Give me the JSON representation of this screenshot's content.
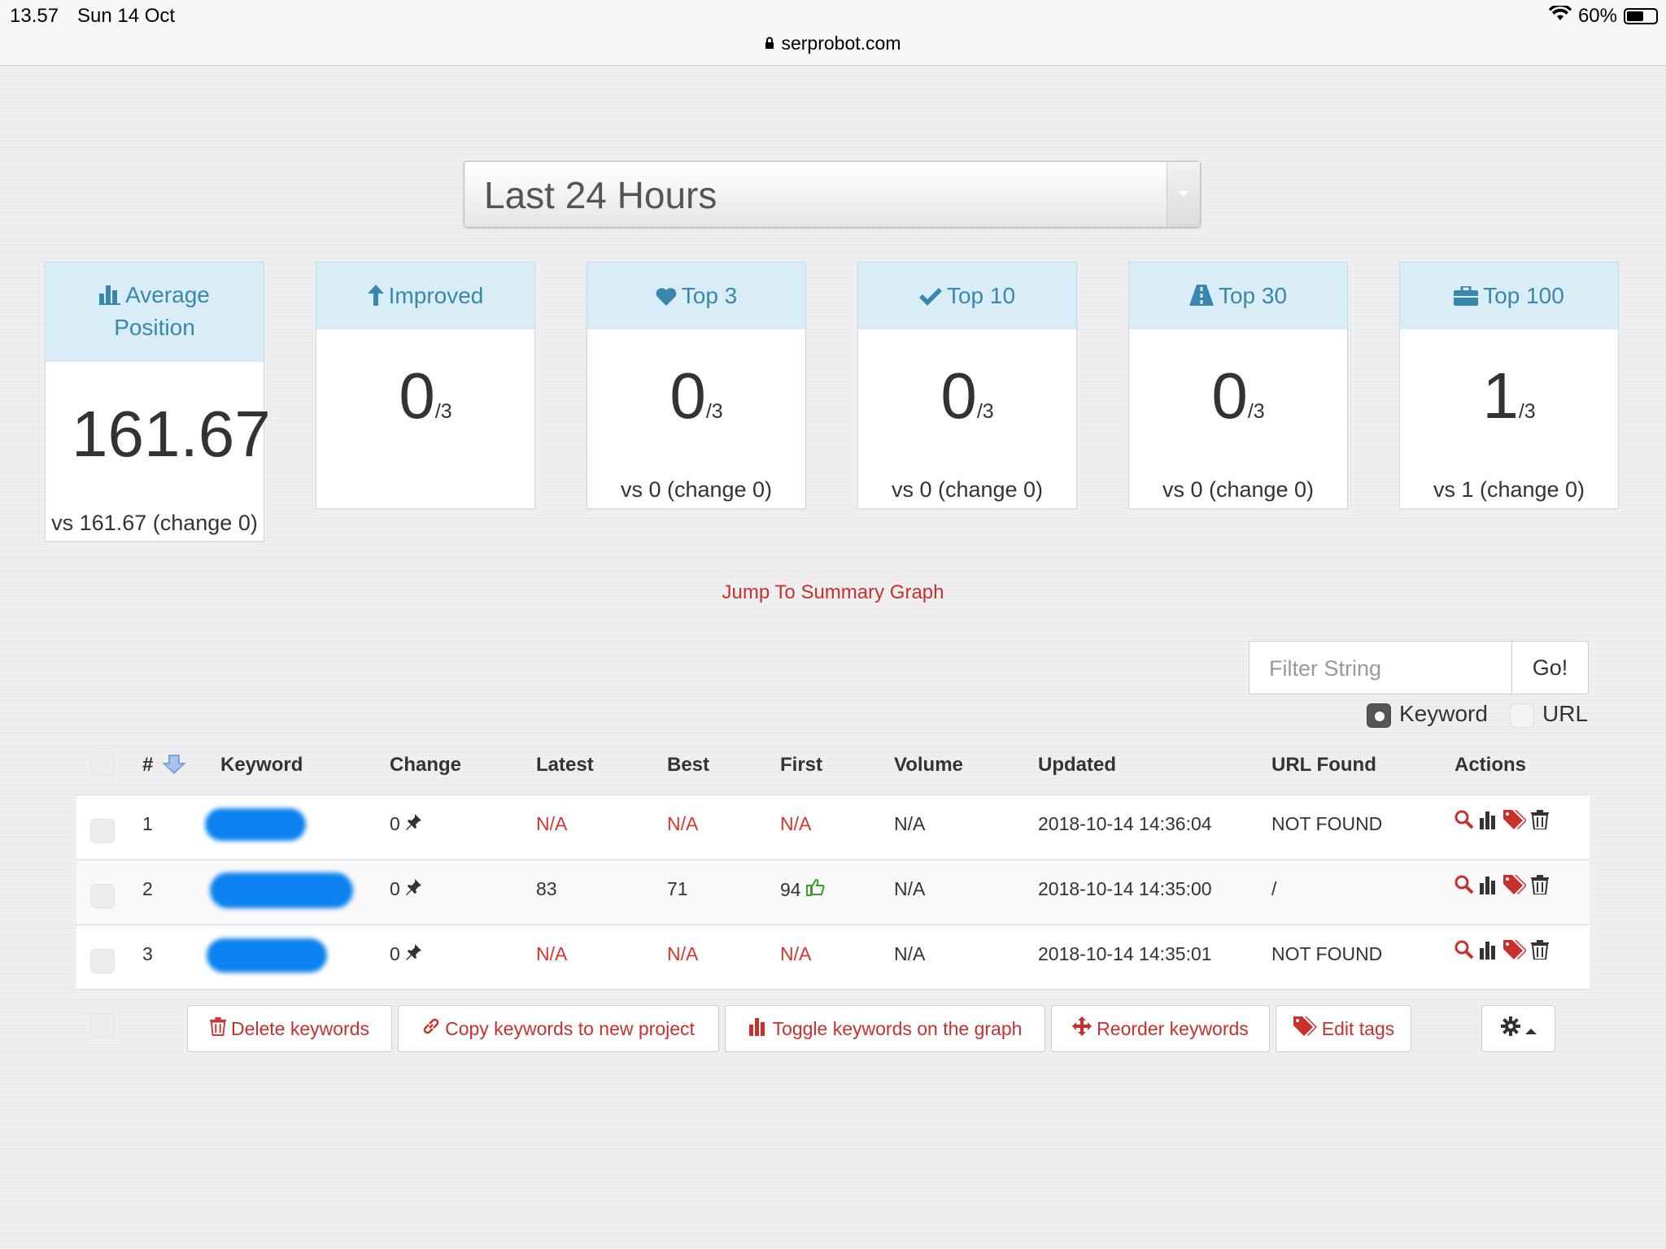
{
  "status_bar": {
    "time": "13.57",
    "date": "Sun 14 Oct",
    "url": "serprobot.com",
    "battery": "60%",
    "battery_level": 0.6
  },
  "range_select": {
    "selected": "Last 24 Hours"
  },
  "cards": [
    {
      "id": "average",
      "label": "Average Position",
      "icon": "bar-chart-icon",
      "value": "161.67",
      "denominator": "",
      "vs": "vs 161.67 (change 0)"
    },
    {
      "id": "improved",
      "label": "Improved",
      "icon": "arrow-up-icon",
      "value": "0",
      "denominator": "/3",
      "vs": ""
    },
    {
      "id": "top3",
      "label": "Top 3",
      "icon": "heart-icon",
      "value": "0",
      "denominator": "/3",
      "vs": "vs 0 (change 0)"
    },
    {
      "id": "top10",
      "label": "Top 10",
      "icon": "check-icon",
      "value": "0",
      "denominator": "/3",
      "vs": "vs 0 (change 0)"
    },
    {
      "id": "top30",
      "label": "Top 30",
      "icon": "road-icon",
      "value": "0",
      "denominator": "/3",
      "vs": "vs 0 (change 0)"
    },
    {
      "id": "top100",
      "label": "Top 100",
      "icon": "briefcase-icon",
      "value": "1",
      "denominator": "/3",
      "vs": "vs 1 (change 0)"
    }
  ],
  "jump_link": "Jump To Summary Graph",
  "filter": {
    "placeholder": "Filter String",
    "go_label": "Go!",
    "options": [
      "Keyword",
      "URL"
    ],
    "selected": "Keyword"
  },
  "table": {
    "columns": [
      "#",
      "Keyword",
      "Change",
      "Latest",
      "Best",
      "First",
      "Volume",
      "Updated",
      "URL Found",
      "Actions"
    ],
    "rows": [
      {
        "num": "1",
        "change": "0",
        "latest": "N/A",
        "best": "N/A",
        "first": "N/A",
        "volume": "N/A",
        "updated": "2018-10-14 14:36:04",
        "url_found": "NOT FOUND"
      },
      {
        "num": "2",
        "change": "0",
        "latest": "83",
        "best": "71",
        "first": "94",
        "volume": "N/A",
        "updated": "2018-10-14 14:35:00",
        "url_found": "/"
      },
      {
        "num": "3",
        "change": "0",
        "latest": "N/A",
        "best": "N/A",
        "first": "N/A",
        "volume": "N/A",
        "updated": "2018-10-14 14:35:01",
        "url_found": "NOT FOUND"
      }
    ]
  },
  "bulk_actions": {
    "delete": "Delete keywords",
    "copy": "Copy keywords to new project",
    "toggle": "Toggle keywords on the graph",
    "reorder": "Reorder keywords",
    "tags": "Edit tags"
  },
  "colors": {
    "card_header_bg": "#d9edf7",
    "card_header_text": "#3a87ad",
    "action_red": "#c9302c",
    "na_red": "#d9342b",
    "keyword_blur": "#0b82f0"
  }
}
